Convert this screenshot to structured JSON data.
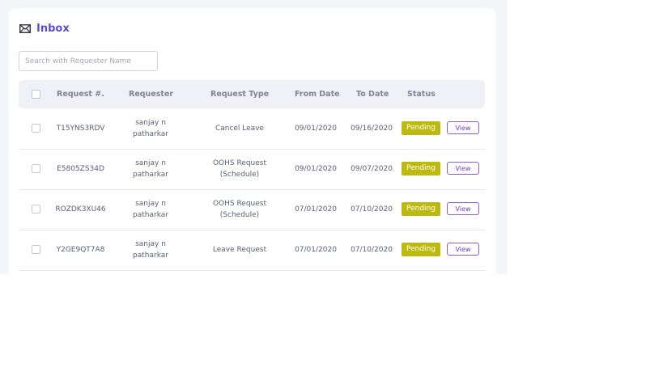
{
  "inbox": {
    "title": "Inbox",
    "icon": "envelope-icon",
    "search_placeholder": "Search with Requester Name"
  },
  "table": {
    "columns": {
      "request_no": "Request #.",
      "requester": "Requester",
      "request_type": "Request Type",
      "from_date": "From Date",
      "to_date": "To Date",
      "status": "Status"
    },
    "rows": [
      {
        "request_no": "T15YNS3RDV",
        "requester": "sanjay n\npatharkar",
        "request_type": "Cancel Leave",
        "from_date": "09/01/2020",
        "to_date": "09/16/2020",
        "status": "Pending",
        "action": "View"
      },
      {
        "request_no": "E5805ZS34D",
        "requester": "sanjay n\npatharkar",
        "request_type": "OOHS Request\n(Schedule)",
        "from_date": "09/01/2020",
        "to_date": "09/07/2020",
        "status": "Pending",
        "action": "View"
      },
      {
        "request_no": "ROZDK3XU46",
        "requester": "sanjay n\npatharkar",
        "request_type": "OOHS Request\n(Schedule)",
        "from_date": "07/01/2020",
        "to_date": "07/10/2020",
        "status": "Pending",
        "action": "View"
      },
      {
        "request_no": "Y2GE9QT7A8",
        "requester": "sanjay n\npatharkar",
        "request_type": "Leave Request",
        "from_date": "07/01/2020",
        "to_date": "07/10/2020",
        "status": "Pending",
        "action": "View"
      }
    ]
  },
  "colors": {
    "accent": "#5a4fcf",
    "pending_badge": "#bcba10",
    "view_button": "#8a5bd6",
    "header_bg": "#eff1f6",
    "page_bg": "#f4f5f8"
  }
}
